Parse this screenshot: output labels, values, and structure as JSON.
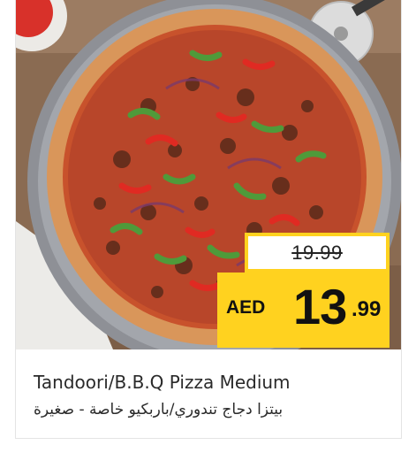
{
  "product": {
    "name_en": "Tandoori/B.B.Q Pizza Medium",
    "name_ar": "بيتزا دجاج تندوري/باربكيو خاصة - صغيرة"
  },
  "pricing": {
    "old_price": "19.99",
    "currency": "AED",
    "price_integer": "13",
    "price_decimal": ".99"
  },
  "image": {
    "subject": "pizza-photo",
    "accent_color": "#ffd21f"
  }
}
